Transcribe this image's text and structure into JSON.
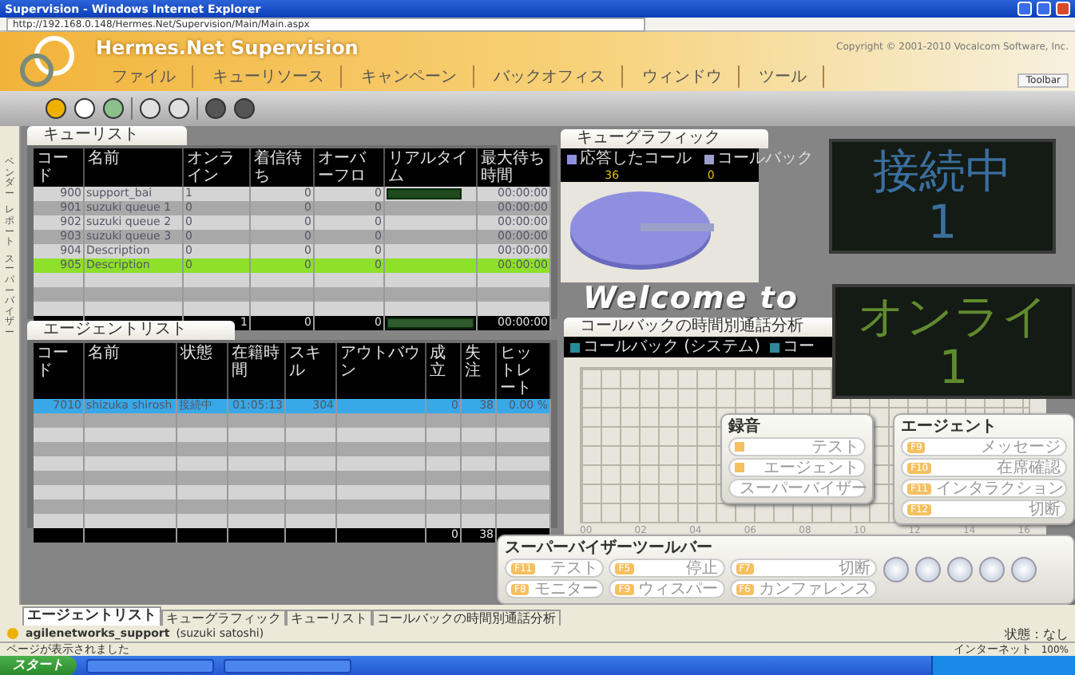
{
  "window": {
    "title": "Supervision - Windows Internet Explorer",
    "address": "http://192.168.0.148/Hermes.Net/Supervision/Main/Main.aspx"
  },
  "header": {
    "brand": "Hermes.Net Supervision",
    "copyright": "Copyright © 2001-2010 Vocalcom Software, Inc.",
    "toolbar_button": "Toolbar"
  },
  "menu": [
    "ファイル",
    "キューリソース",
    "キャンペーン",
    "バックオフィス",
    "ウィンドウ",
    "ツール"
  ],
  "sidebar": {
    "items": [
      "ベンダー",
      "レポート",
      "スーパーバイザー"
    ]
  },
  "queue_list": {
    "title": "キューリスト",
    "columns": [
      "コード",
      "名前",
      "オンライン",
      "着信待ち",
      "オーバーフロ",
      "リアルタイム",
      "最大待ち時間"
    ],
    "rows": [
      {
        "cells": [
          "900",
          "support_bai",
          "1",
          "0",
          "0",
          "",
          "00:00:00"
        ],
        "level": 0.85,
        "selected": false
      },
      {
        "cells": [
          "901",
          "suzuki queue 1",
          "0",
          "0",
          "0",
          "",
          "00:00:00"
        ],
        "selected": false
      },
      {
        "cells": [
          "902",
          "suzuki queue 2",
          "0",
          "0",
          "0",
          "",
          "00:00:00"
        ],
        "selected": false
      },
      {
        "cells": [
          "903",
          "suzuki queue 3",
          "0",
          "0",
          "0",
          "",
          "00:00:00"
        ],
        "selected": false
      },
      {
        "cells": [
          "904",
          "Description",
          "0",
          "0",
          "0",
          "",
          "00:00:00"
        ],
        "selected": false
      },
      {
        "cells": [
          "905",
          "Description",
          "0",
          "0",
          "0",
          "",
          "00:00:00"
        ],
        "selected": true
      }
    ],
    "total": {
      "cells": [
        "",
        "",
        "1",
        "0",
        "0",
        "",
        "00:00:00"
      ],
      "level": 1
    }
  },
  "agent_list": {
    "title": "エージェントリスト",
    "columns": [
      "コード",
      "名前",
      "状態",
      "在籍時間",
      "スキル",
      "アウトバウン",
      "成立",
      "失注",
      "ヒットレート"
    ],
    "rows": [
      {
        "cells": [
          "7010",
          "shizuka shirosh",
          "接続中",
          "01:05:13",
          "304",
          "",
          "0",
          "38",
          "0.00 %"
        ],
        "selected": true
      }
    ],
    "total": {
      "cells": [
        "",
        "",
        "",
        "",
        "",
        "",
        "0",
        "38",
        ""
      ]
    }
  },
  "queue_graphic": {
    "title": "キューグラフィック",
    "legend": [
      {
        "label": "応答したコール",
        "color": "#8f8fe0",
        "value": "36"
      },
      {
        "label": "コールバック",
        "color": "#9aa0c8",
        "value": "0"
      }
    ]
  },
  "welcome": "Welcome to",
  "counters": [
    {
      "label": "接続中",
      "value": "1",
      "color": "#3a6f9e"
    },
    {
      "label": "オンライ",
      "value": "1",
      "color": "#5f8a2e"
    }
  ],
  "callback_chart": {
    "title": "コールバックの時間別通話分析",
    "legend": [
      {
        "label": "コールバック (システム)",
        "color": "#2a8a9a"
      },
      {
        "label": "コー",
        "color": "#2a8a9a"
      }
    ],
    "ticks": [
      "00",
      "02",
      "04",
      "06",
      "08",
      "10",
      "12",
      "14",
      "16"
    ]
  },
  "recording": {
    "title": "録音",
    "items": [
      "テスト",
      "エージェント",
      "スーパーバイザー"
    ]
  },
  "agent_panel": {
    "title": "エージェント",
    "items": [
      {
        "key": "F9",
        "label": "メッセージ"
      },
      {
        "key": "F10",
        "label": "在席確認"
      },
      {
        "key": "F11",
        "label": "インタラクション"
      },
      {
        "key": "F12",
        "label": "切断"
      }
    ]
  },
  "supervisor_toolbar": {
    "title": "スーパーバイザーツールバー",
    "buttons": [
      {
        "key": "F11",
        "label": "テスト"
      },
      {
        "key": "F5",
        "label": "停止"
      },
      {
        "key": "F7",
        "label": "切断"
      },
      {
        "key": "F8",
        "label": "モニター"
      },
      {
        "key": "F9",
        "label": "ウィスパー"
      },
      {
        "key": "F6",
        "label": "カンファレンス"
      }
    ]
  },
  "bottom_tabs": [
    {
      "label": "エージェントリスト",
      "selected": true
    },
    {
      "label": "キューグラフィック",
      "selected": false
    },
    {
      "label": "キューリスト",
      "selected": false
    },
    {
      "label": "コールバックの時間別通話分析",
      "selected": false
    }
  ],
  "status": {
    "user": "agilenetworks_support",
    "detail": "(suzuki satoshi)",
    "state": "状態：なし"
  },
  "ie_status": {
    "message": "ページが表示されました",
    "zone": "インターネット",
    "zoom": "100%"
  },
  "taskbar": {
    "start": "スタート"
  }
}
